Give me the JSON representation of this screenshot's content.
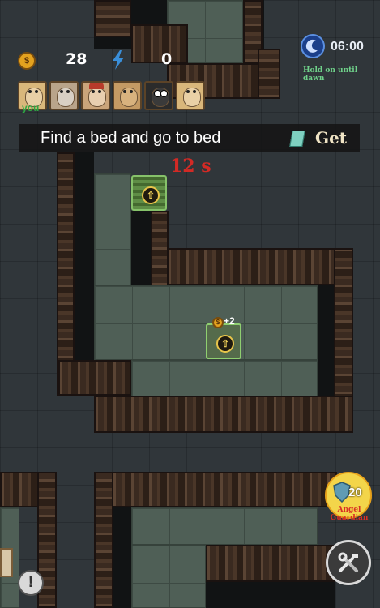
{
  "hud": {
    "coin_icon": "dollar-coin-icon",
    "coin_symbol": "$",
    "coins": "28",
    "energy_icon": "lightning-icon",
    "energy": "0",
    "timer_icon": "moon-clock-icon",
    "timer": "06:00",
    "hint": "Hold on until dawn"
  },
  "players": {
    "self_label": "you",
    "avatars": [
      "survivor-1",
      "survivor-2",
      "survivor-3",
      "survivor-4",
      "survivor-5",
      "survivor-6"
    ]
  },
  "task": {
    "text": "Find a bed and go to bed",
    "reward_label": "Get",
    "reward_icon": "crystal-icon",
    "countdown": "12 s"
  },
  "bed": {
    "bonus": "+2",
    "bonus_icon": "coin-icon"
  },
  "angel_guardian": {
    "count": "20",
    "label": "Angel Guardian",
    "icon": "shield-icon"
  },
  "build_button": {
    "icon": "tools-icon"
  },
  "alert_button": {
    "symbol": "!",
    "icon": "alert-icon"
  }
}
